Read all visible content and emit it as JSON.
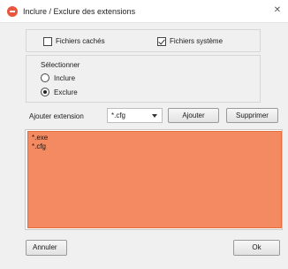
{
  "window": {
    "title": "Inclure / Exclure des extensions"
  },
  "files_group": {
    "hidden_files": {
      "label": "Fichiers cachés",
      "checked": false
    },
    "system_files": {
      "label": "Fichiers système",
      "checked": true
    }
  },
  "select_group": {
    "label": "Sélectionner",
    "options": [
      {
        "label": "Inclure",
        "checked": false
      },
      {
        "label": "Exclure",
        "checked": true
      }
    ]
  },
  "extension": {
    "label": "Ajouter extension",
    "selected": "*.cfg",
    "add_label": "Ajouter",
    "delete_label": "Supprimer"
  },
  "list": {
    "items": [
      "*.exe",
      "*.cfg"
    ],
    "highlight_color": "#f38a62"
  },
  "footer": {
    "cancel_label": "Annuler",
    "ok_label": "Ok"
  },
  "icons": {
    "app": "app-logo-icon",
    "close": "close-icon",
    "dropdown": "chevron-down-icon"
  }
}
